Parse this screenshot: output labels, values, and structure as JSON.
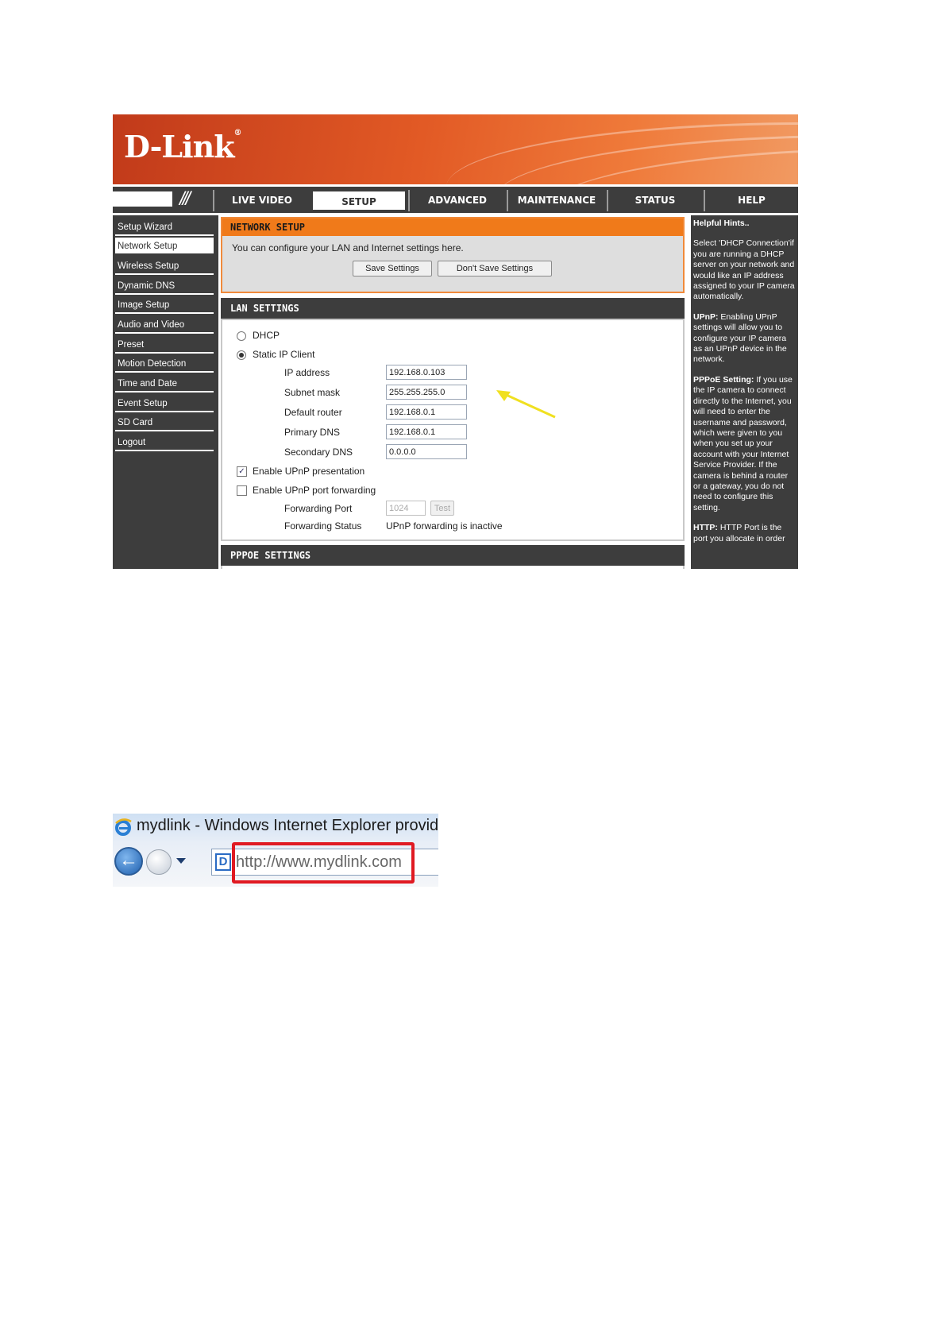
{
  "dlink": {
    "logo": "D-Link",
    "tabs": [
      "LIVE VIDEO",
      "SETUP",
      "ADVANCED",
      "MAINTENANCE",
      "STATUS",
      "HELP"
    ],
    "active_tab": "SETUP",
    "sidebar": [
      "Setup Wizard",
      "Network Setup",
      "Wireless Setup",
      "Dynamic DNS",
      "Image Setup",
      "Audio and Video",
      "Preset",
      "Motion Detection",
      "Time and Date",
      "Event Setup",
      "SD Card",
      "Logout"
    ],
    "active_sidebar": "Network Setup",
    "network_setup": {
      "title": "NETWORK SETUP",
      "description": "You can configure your LAN and Internet settings here.",
      "save_label": "Save Settings",
      "dont_save_label": "Don't Save Settings"
    },
    "lan": {
      "title": "LAN SETTINGS",
      "dhcp_label": "DHCP",
      "static_label": "Static IP Client",
      "selected": "Static IP Client",
      "ip_label": "IP address",
      "ip_value": "192.168.0.103",
      "subnet_label": "Subnet mask",
      "subnet_value": "255.255.255.0",
      "router_label": "Default router",
      "router_value": "192.168.0.1",
      "dns1_label": "Primary DNS",
      "dns1_value": "192.168.0.1",
      "dns2_label": "Secondary DNS",
      "dns2_value": "0.0.0.0",
      "upnp_presentation_label": "Enable UPnP presentation",
      "upnp_presentation_checked": true,
      "upnp_forwarding_label": "Enable UPnP port forwarding",
      "upnp_forwarding_checked": false,
      "fwd_port_label": "Forwarding Port",
      "fwd_port_value": "1024",
      "test_label": "Test",
      "fwd_status_label": "Forwarding Status",
      "fwd_status_value": "UPnP forwarding is inactive"
    },
    "pppoe_title": "PPPOE SETTINGS",
    "hints": {
      "title": "Helpful Hints..",
      "dhcp": "Select 'DHCP Connection'if you are running a DHCP server on your network and would like an IP address assigned to your IP camera automatically.",
      "upnp_head": "UPnP:",
      "upnp": "Enabling UPnP settings will allow you to configure your IP camera as an UPnP device in the network.",
      "pppoe_head": "PPPoE Setting:",
      "pppoe": "If you use the IP camera to connect directly to the Internet, you will need to enter the username and password, which were given to you when you set up your account with your Internet Service Provider. If the camera is behind a router or a gateway, you do not need to configure this setting.",
      "http_head": "HTTP:",
      "http": "HTTP Port is the port you allocate in order"
    },
    "colors": {
      "banner": "#e25a25",
      "dark": "#3d3d3d",
      "section_orange": "#f07a1a",
      "arrow": "#f0e020"
    }
  },
  "ie": {
    "title": "mydlink - Windows Internet Explorer provide",
    "url": "http://www.mydlink.com",
    "colors": {
      "highlight": "#e01a22"
    }
  }
}
